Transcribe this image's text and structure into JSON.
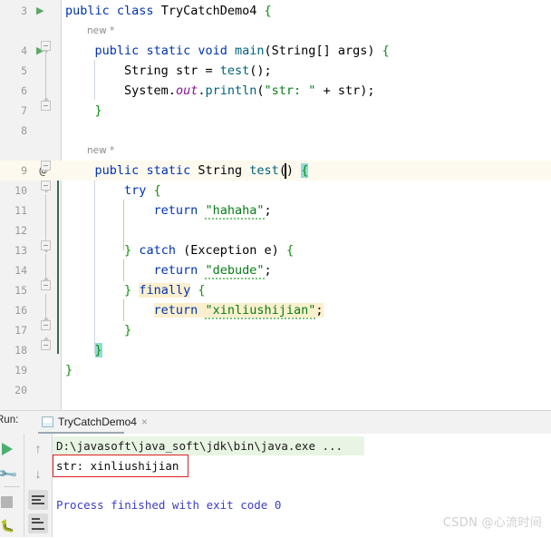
{
  "app": {
    "name": "IntelliJ IDEA Editor"
  },
  "editor": {
    "lines": [
      {
        "num": "3",
        "runMarker": true,
        "at": false,
        "code_html": "<span class='kw'>public</span> <span class='kw'>class</span> <span class='cls'>TryCatchDemo4</span> <span class='brc'>{</span>",
        "text": "public class TryCatchDemo4 {"
      },
      {
        "num": "",
        "hint": "new *",
        "text": "new *"
      },
      {
        "num": "4",
        "runMarker": true,
        "at": false,
        "code_html": "    <span class='kw'>public</span> <span class='kw'>static</span> <span class='kw'>void</span> <span class='meth'>main</span><span class='br'>(</span><span class='cls'>String</span><span class='br'>[]</span> <span class='plain'>args</span><span class='br'>)</span> <span class='brc'>{</span>",
        "text": "public static void main(String[] args) {"
      },
      {
        "num": "5",
        "code_html": "        <span class='cls'>String</span> <span class='plain'>str</span> <span class='plain'>=</span> <span class='meth'>test</span><span class='br'>();</span>",
        "text": "String str = test();"
      },
      {
        "num": "6",
        "code_html": "        <span class='cls'>System</span>.<span class='fld'>out</span>.<span class='meth'>println</span><span class='br'>(</span><span class='str'>\"str: \"</span> <span class='plain'>+</span> <span class='plain'>str</span><span class='br'>);</span>",
        "text": "System.out.println(\"str: \" + str);"
      },
      {
        "num": "7",
        "code_html": "    <span class='brc'>}</span>",
        "text": "}"
      },
      {
        "num": "8",
        "code_html": "",
        "text": ""
      },
      {
        "num": "",
        "hint": "new *",
        "text": "new *"
      },
      {
        "num": "9",
        "at": true,
        "caretRow": true,
        "code_html": "    <span class='kw'>public</span> <span class='kw'>static</span> <span class='cls'>String</span> <span class='meth'>test</span><span class='br'>()</span> <span class='hl-brace brc'>{</span>",
        "text": "public static String test() {"
      },
      {
        "num": "10",
        "code_html": "        <span class='kw'>try</span> <span class='brc'>{</span>",
        "text": "try {"
      },
      {
        "num": "11",
        "code_html": "            <span class='kw'>return</span> <span class='str squig'>\"hahaha\"</span><span class='br'>;</span>",
        "text": "return \"hahaha\";"
      },
      {
        "num": "12",
        "code_html": "",
        "text": ""
      },
      {
        "num": "13",
        "code_html": "        <span class='brc'>}</span> <span class='kw'>catch</span> <span class='br'>(</span><span class='cls'>Exception</span> <span class='plain'>e</span><span class='br'>)</span> <span class='brc'>{</span>",
        "text": "} catch (Exception e) {"
      },
      {
        "num": "14",
        "code_html": "            <span class='kw'>return</span> <span class='str squig'>\"debude\"</span><span class='br'>;</span>",
        "text": "return \"debude\";"
      },
      {
        "num": "15",
        "code_html": "        <span class='brc'>}</span> <span class='hl-usage kw'>finally</span> <span class='brc'>{</span>",
        "text": "} finally {"
      },
      {
        "num": "16",
        "code_html": "            <span class='hl-usage'><span class='kw'>return</span> <span class='str squig'>\"xinliushijian\"</span><span class='br'>;</span></span>",
        "text": "return \"xinliushijian\";"
      },
      {
        "num": "17",
        "code_html": "        <span class='brc'>}</span>",
        "text": "}"
      },
      {
        "num": "18",
        "code_html": "    <span class='hl-brace brc'>}</span>",
        "text": "}"
      },
      {
        "num": "19",
        "code_html": "<span class='brc'>}</span>",
        "text": "}"
      },
      {
        "num": "20",
        "code_html": "",
        "text": ""
      }
    ]
  },
  "run_window": {
    "label": "Run:",
    "tab_title": "TryCatchDemo4",
    "tab_close": "×",
    "toolbar": {
      "rerun": "rerun-button",
      "settings": "settings-button",
      "stop": "stop-button",
      "close": "close-button",
      "up": "↑",
      "down": "↓",
      "soft_wrap": "soft-wrap-button",
      "scroll_end": "scroll-to-end-button"
    },
    "console": {
      "command": "D:\\javasoft\\java_soft\\jdk\\bin\\java.exe ...",
      "output": "str: xinliushijian",
      "finished": "Process finished with exit code 0"
    }
  },
  "watermark": "CSDN @心流时间",
  "colors": {
    "keyword": "#0033b3",
    "string": "#067d17",
    "method": "#00627a",
    "field": "#871094",
    "brace": "#0e8f0e",
    "caret_row": "#fdf9ee",
    "usage_highlight": "#fbefcd",
    "brace_match": "#93d9d9",
    "console_cmd_bg": "#e9f5e4",
    "console_finished": "#3d3dcc",
    "annotation_box": "#e02020",
    "run_green": "#4caf70"
  }
}
